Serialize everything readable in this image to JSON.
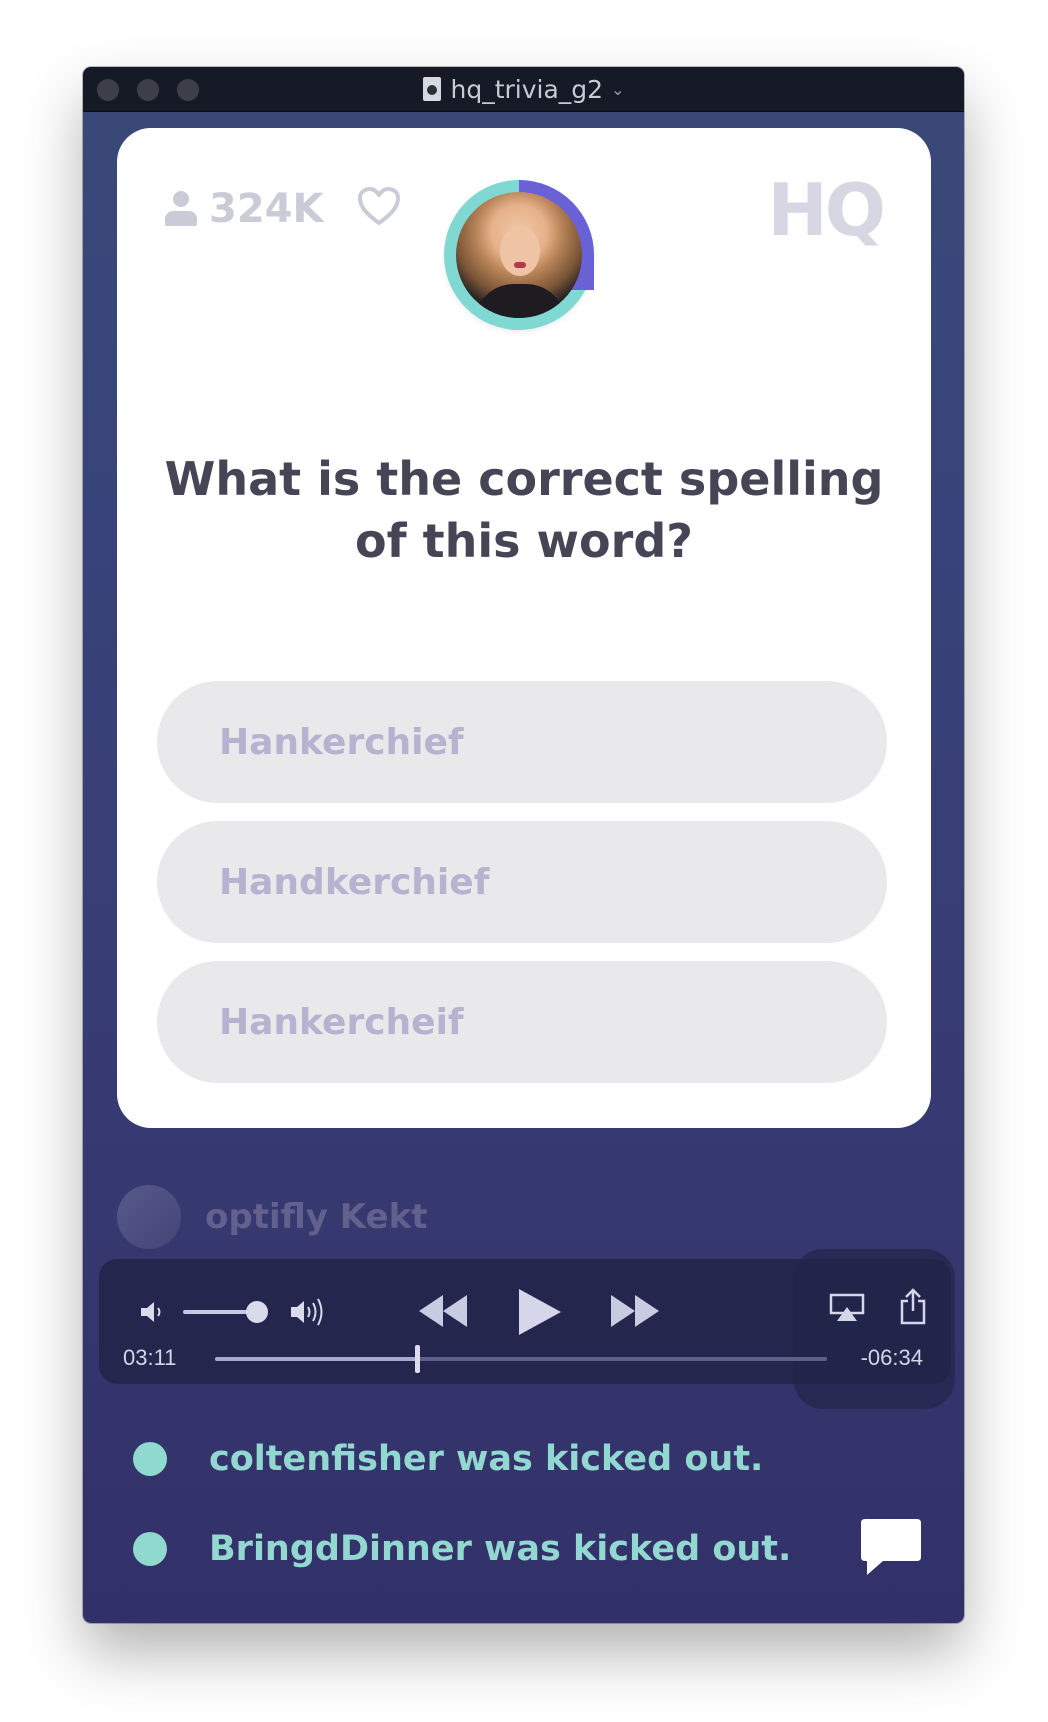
{
  "window": {
    "title": "hq_trivia_g2"
  },
  "header": {
    "viewer_count": "324K",
    "logo": "HQ"
  },
  "question": {
    "text": "What is the correct spelling of this word?"
  },
  "answers": [
    {
      "label": "Hankerchief"
    },
    {
      "label": "Handkerchief"
    },
    {
      "label": "Hankercheif"
    }
  ],
  "chat": {
    "faded_user": "optifly Kekt",
    "events": [
      {
        "text": "coltenfisher was kicked out."
      },
      {
        "text": "BringdDinner was kicked out."
      }
    ]
  },
  "player": {
    "current_time": "03:11",
    "remaining_time": "-06:34",
    "progress": 0.33,
    "volume": 0.9
  },
  "colors": {
    "accent_teal": "#8fd9cf",
    "accent_purple": "#6b61d6",
    "background": "#37437a"
  },
  "icons": [
    "document-icon",
    "chevron-down-icon",
    "person-icon",
    "heart-icon",
    "volume-low-icon",
    "volume-high-icon",
    "rewind-icon",
    "play-icon",
    "fast-forward-icon",
    "airplay-icon",
    "share-icon",
    "chat-bubble-icon"
  ]
}
